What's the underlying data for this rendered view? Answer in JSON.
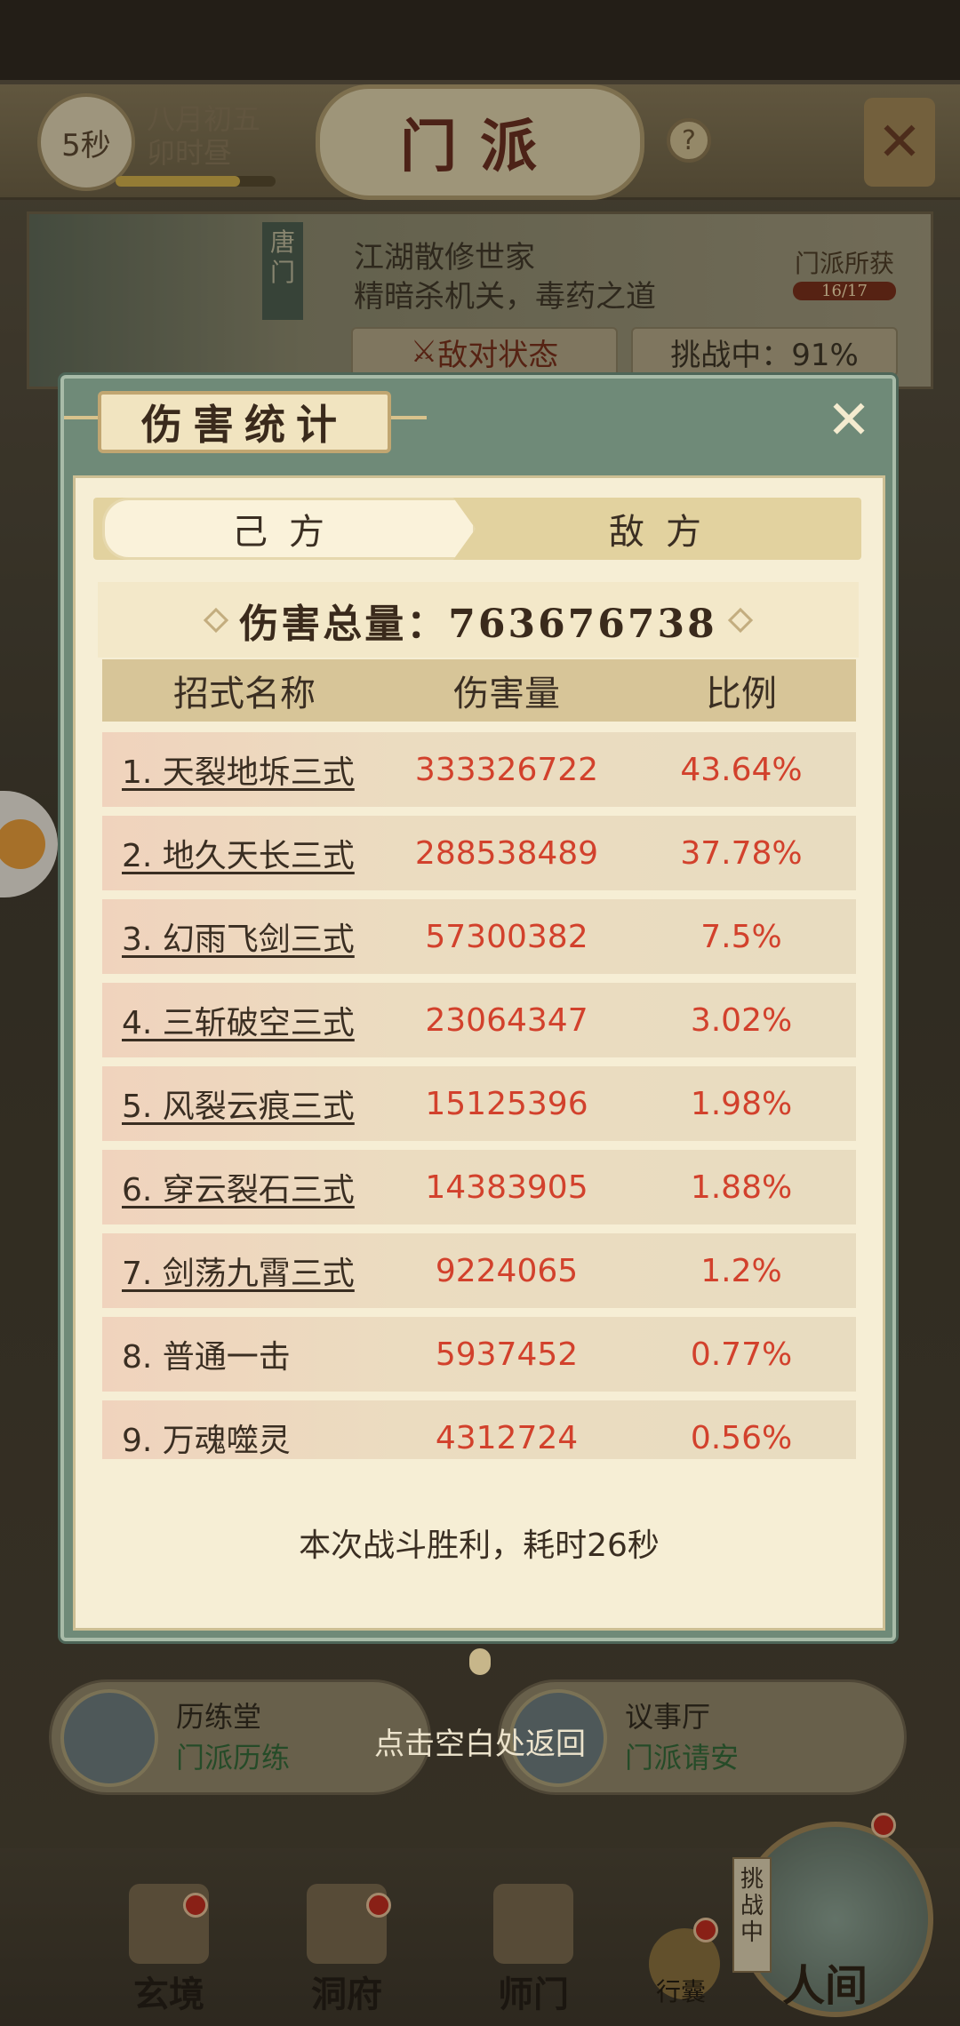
{
  "top": {
    "timer": "5秒",
    "date_line1": "八月初五",
    "date_line2": "卯时昼",
    "title": "门派",
    "help": "?"
  },
  "sect": {
    "tag": "唐门",
    "desc_line1": "江湖散修世家",
    "desc_line2": "精暗杀机关，毒药之道",
    "obtain_label": "门派所获",
    "obtain_count": "16/17",
    "enemy_state": "敌对状态",
    "challenge": "挑战中：91%"
  },
  "dialog": {
    "title": "伤害统计",
    "tabs": [
      "己方",
      "敌方"
    ],
    "total_label": "伤害总量：763676738",
    "headers": [
      "招式名称",
      "伤害量",
      "比例"
    ],
    "rows": [
      {
        "name": "1. 天裂地坼三式",
        "damage": "333326722",
        "pct": "43.64%"
      },
      {
        "name": "2. 地久天长三式",
        "damage": "288538489",
        "pct": "37.78%"
      },
      {
        "name": "3. 幻雨飞剑三式",
        "damage": "57300382",
        "pct": "7.5%"
      },
      {
        "name": "4. 三斩破空三式",
        "damage": "23064347",
        "pct": "3.02%"
      },
      {
        "name": "5. 风裂云痕三式",
        "damage": "15125396",
        "pct": "1.98%"
      },
      {
        "name": "6. 穿云裂石三式",
        "damage": "14383905",
        "pct": "1.88%"
      },
      {
        "name": "7. 剑荡九霄三式",
        "damage": "9224065",
        "pct": "1.2%"
      },
      {
        "name": "8. 普通一击",
        "damage": "5937452",
        "pct": "0.77%"
      },
      {
        "name": "9. 万魂噬灵",
        "damage": "4312724",
        "pct": "0.56%"
      }
    ],
    "result": "本次战斗胜利，耗时26秒"
  },
  "bottom": {
    "hall_left_name": "历练堂",
    "hall_left_sub": "门派历练",
    "hall_right_name": "议事厅",
    "hall_right_sub": "门派请安",
    "return_hint": "点击空白处返回",
    "nav": [
      "玄境",
      "洞府",
      "师门"
    ],
    "bag": "行囊",
    "challenge_tag": "挑战中",
    "world": "人间"
  }
}
